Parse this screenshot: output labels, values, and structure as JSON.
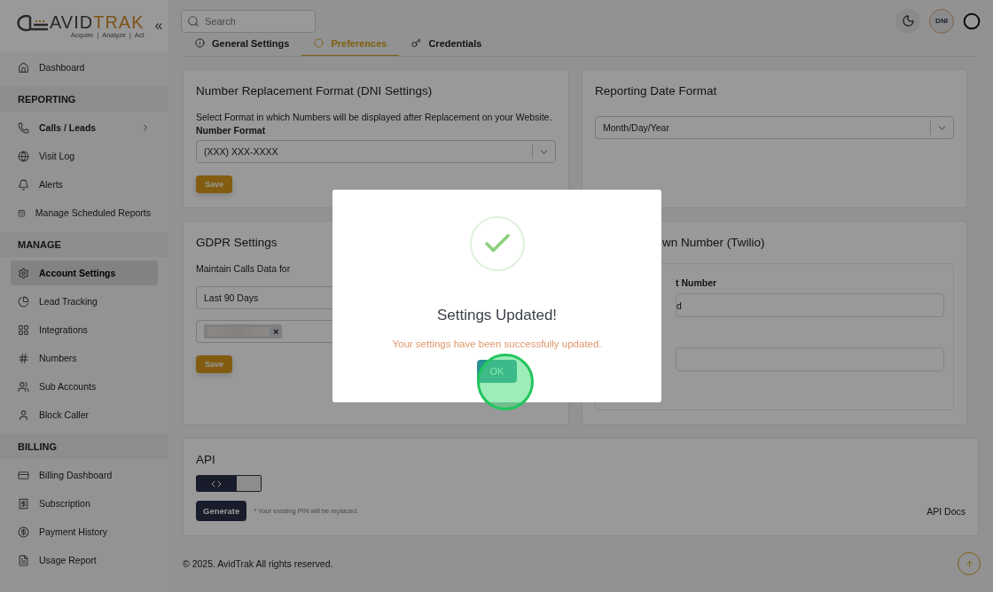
{
  "logo": {
    "brand_dark": "AVID",
    "brand_accent": "TRAK",
    "tagline": "Acquire  |  Analyze  |  Act",
    "collapse": "«"
  },
  "sidebar": {
    "sections": [
      {
        "items": [
          {
            "label": "Dashboard",
            "selected": false
          }
        ]
      },
      {
        "heading": "REPORTING",
        "items": [
          {
            "label": "Calls / Leads",
            "selected": false,
            "has_children": true
          },
          {
            "label": "Visit Log",
            "selected": false
          },
          {
            "label": "Alerts",
            "selected": false
          },
          {
            "label": "Manage Scheduled Reports",
            "selected": false
          }
        ]
      },
      {
        "heading": "MANAGE",
        "items": [
          {
            "label": "Account Settings",
            "selected": true
          },
          {
            "label": "Lead Tracking",
            "selected": false
          },
          {
            "label": "Integrations",
            "selected": false
          },
          {
            "label": "Numbers",
            "selected": false
          },
          {
            "label": "Sub Accounts",
            "selected": false
          },
          {
            "label": "Block Caller",
            "selected": false
          }
        ]
      },
      {
        "heading": "BILLING",
        "items": [
          {
            "label": "Billing Dashboard",
            "selected": false
          },
          {
            "label": "Subscription",
            "selected": false
          },
          {
            "label": "Payment History",
            "selected": false
          },
          {
            "label": "Usage Report",
            "selected": false
          }
        ]
      }
    ]
  },
  "header": {
    "search": {
      "placeholder": "Search"
    },
    "avatar": "DNI"
  },
  "tabs": [
    {
      "label": "General Settings",
      "selected": false
    },
    {
      "label": "Preferences",
      "selected": true
    },
    {
      "label": "Credentials",
      "selected": false
    }
  ],
  "number_format_card": {
    "title": "Number Replacement Format (DNI Settings)",
    "description": "Select Format in which Numbers will be displayed after Replacement on your Website.",
    "field_label": "Number Format",
    "value": "(XXX) XXX-XXXX",
    "save": "Save"
  },
  "date_format_card": {
    "title": "Reporting Date Format",
    "value": "Month/Day/Year"
  },
  "gdpr_card": {
    "title": "GDPR Settings",
    "label": "Maintain Calls Data for",
    "value": "Last 90 Days",
    "chip_remove": "×",
    "save": "Save"
  },
  "twilio_card": {
    "title": "wn Number (Twilio)",
    "field_label": "t Number",
    "value": "d"
  },
  "api_card": {
    "title": "API",
    "toggle_on": true,
    "generate": "Generate",
    "note": "* Your existing PIN will be replaced.",
    "docs_link": "API Docs"
  },
  "footer": "© 2025. AvidTrak All rights reserved.",
  "dialog": {
    "title": "Settings Updated!",
    "message": "Your settings have been successfully updated.",
    "ok": "OK"
  }
}
